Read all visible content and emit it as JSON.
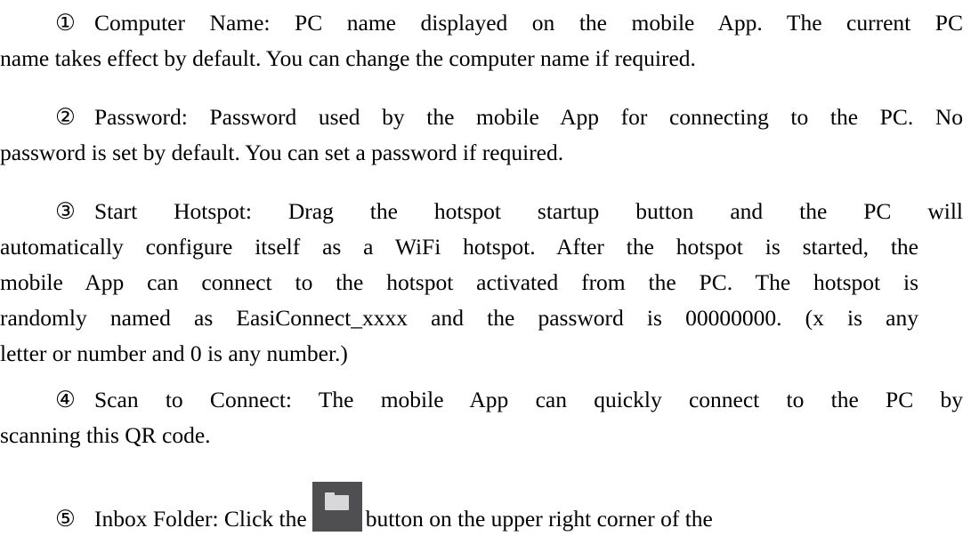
{
  "items": [
    {
      "marker": "①",
      "lines": [
        "Computer Name: PC name displayed on the mobile App. The current PC",
        "name takes effect by default. You can change the computer name if required."
      ]
    },
    {
      "marker": "②",
      "lines": [
        "Password: Password used by the mobile App for connecting to the PC. No",
        "password is set by default. You can set a password if required."
      ]
    },
    {
      "marker": "③",
      "lines": [
        "Start Hotspot: Drag the hotspot startup button and the PC will",
        "automatically configure itself as a WiFi hotspot. After the hotspot is started, the",
        "mobile App can connect to the hotspot activated from the PC. The hotspot is",
        "randomly named as EasiConnect_xxxx and the password is 00000000. (x is any",
        "letter or number and 0 is any number.)"
      ]
    },
    {
      "marker": "④",
      "lines": [
        "Scan to Connect: The mobile App can quickly connect to the PC by",
        "scanning this QR code."
      ]
    },
    {
      "marker": "⑤",
      "before_icon": "Inbox Folder: Click the",
      "after_icon": "button on the upper right corner of the",
      "icon": "folder-icon"
    }
  ],
  "colors": {
    "text": "#000000",
    "icon_button_bg": "#4f4f52",
    "icon_glyph": "#d8d8d8"
  }
}
